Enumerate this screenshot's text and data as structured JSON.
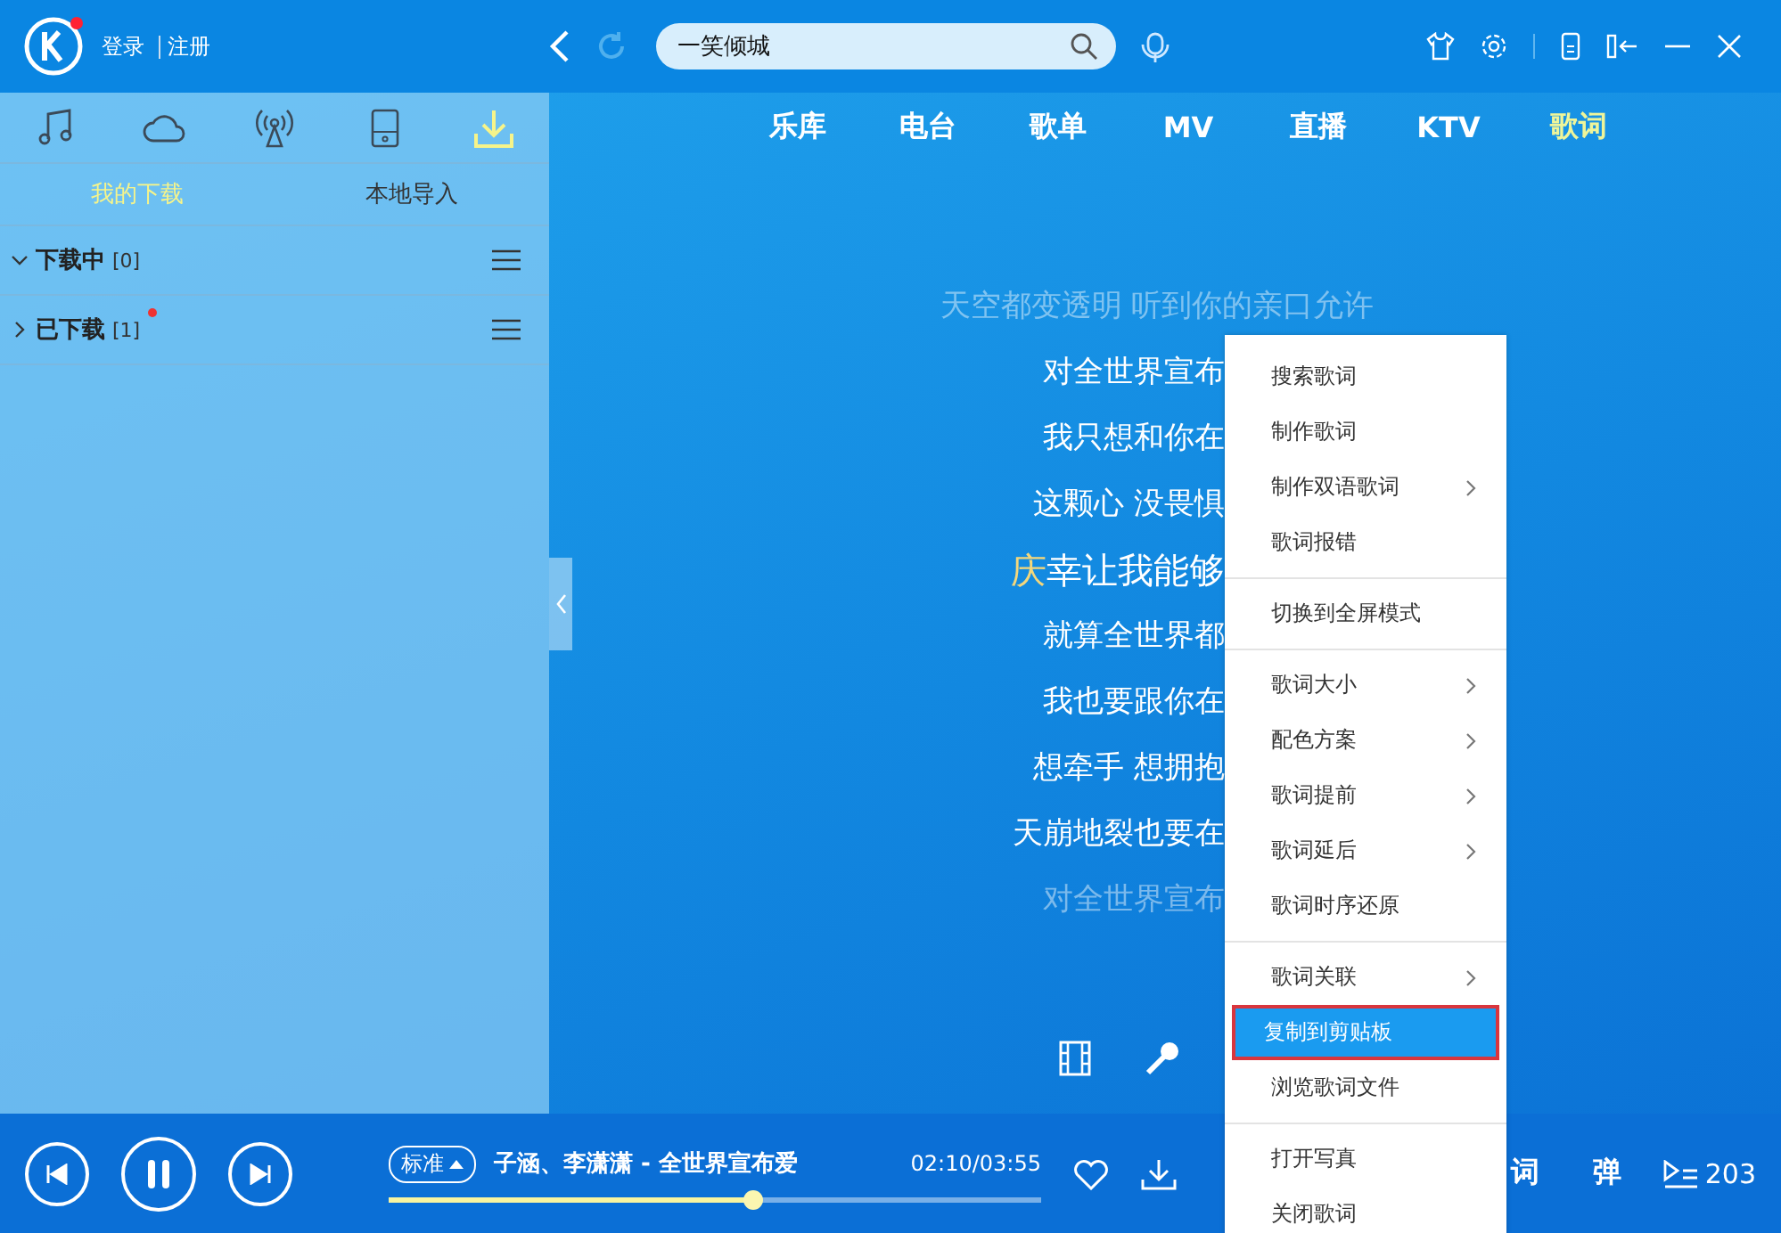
{
  "topbar": {
    "login": "登录",
    "register": "注册",
    "search": {
      "value": "一笑倾城"
    }
  },
  "nav": [
    {
      "label": "乐库",
      "selected": false
    },
    {
      "label": "电台",
      "selected": false
    },
    {
      "label": "歌单",
      "selected": false
    },
    {
      "label": "MV",
      "selected": false
    },
    {
      "label": "直播",
      "selected": false
    },
    {
      "label": "KTV",
      "selected": false
    },
    {
      "label": "歌词",
      "selected": true
    }
  ],
  "sidebar": {
    "icon_tabs": [
      {
        "kind": "music",
        "selected": false
      },
      {
        "kind": "cloud",
        "selected": false
      },
      {
        "kind": "radio",
        "selected": false
      },
      {
        "kind": "phone",
        "selected": false
      },
      {
        "kind": "download",
        "selected": true
      }
    ],
    "sub_tabs": [
      {
        "label": "我的下载",
        "selected": true
      },
      {
        "label": "本地导入",
        "selected": false
      }
    ],
    "groups": [
      {
        "title": "下载中",
        "count": "[0]",
        "expanded": true,
        "new": false
      },
      {
        "title": "已下载",
        "count": "[1]",
        "expanded": false,
        "new": true
      }
    ]
  },
  "lyrics": [
    {
      "kind": "whole",
      "text": "天空都变透明 听到你的亲口允许",
      "dim": true
    },
    {
      "kind": "cut",
      "text": "对全世界宣布",
      "dim": false
    },
    {
      "kind": "cut",
      "text": "我只想和你在",
      "dim": false
    },
    {
      "kind": "cut",
      "text": "这颗心 没畏惧",
      "dim": false
    },
    {
      "kind": "cut",
      "sung": "庆",
      "text": "幸让我能够",
      "dim": false
    },
    {
      "kind": "cut",
      "text": "就算全世界都",
      "dim": false
    },
    {
      "kind": "cut",
      "text": "我也要跟你在",
      "dim": false
    },
    {
      "kind": "cut",
      "text": "想牵手 想拥抱",
      "dim": false
    },
    {
      "kind": "cut",
      "text": "天崩地裂也要在",
      "dim": false
    },
    {
      "kind": "cut",
      "text": "对全世界宣布",
      "dim": true
    }
  ],
  "context_menu": [
    {
      "label": "搜索歌词",
      "submenu": false,
      "selected": false,
      "divider_after": false
    },
    {
      "label": "制作歌词",
      "submenu": false,
      "selected": false,
      "divider_after": false
    },
    {
      "label": "制作双语歌词",
      "submenu": true,
      "selected": false,
      "divider_after": false
    },
    {
      "label": "歌词报错",
      "submenu": false,
      "selected": false,
      "divider_after": true
    },
    {
      "label": "切换到全屏模式",
      "submenu": false,
      "selected": false,
      "divider_after": true
    },
    {
      "label": "歌词大小",
      "submenu": true,
      "selected": false,
      "divider_after": false
    },
    {
      "label": "配色方案",
      "submenu": true,
      "selected": false,
      "divider_after": false
    },
    {
      "label": "歌词提前",
      "submenu": true,
      "selected": false,
      "divider_after": false
    },
    {
      "label": "歌词延后",
      "submenu": true,
      "selected": false,
      "divider_after": false
    },
    {
      "label": "歌词时序还原",
      "submenu": false,
      "selected": false,
      "divider_after": true
    },
    {
      "label": "歌词关联",
      "submenu": true,
      "selected": false,
      "divider_after": false
    },
    {
      "label": "复制到剪贴板",
      "submenu": false,
      "selected": true,
      "divider_after": false
    },
    {
      "label": "浏览歌词文件",
      "submenu": false,
      "selected": false,
      "divider_after": true
    },
    {
      "label": "打开写真",
      "submenu": false,
      "selected": false,
      "divider_after": false
    },
    {
      "label": "关闭歌词",
      "submenu": false,
      "selected": false,
      "divider_after": false
    }
  ],
  "player": {
    "quality": "标准",
    "song": "子涵、李潇潇 - 全世界宣布爱",
    "time": "02:10/03:55",
    "progress": {
      "level": 0.56
    },
    "lyric_button": "词",
    "danmaku_button": "弹",
    "playlist_count": "203"
  }
}
